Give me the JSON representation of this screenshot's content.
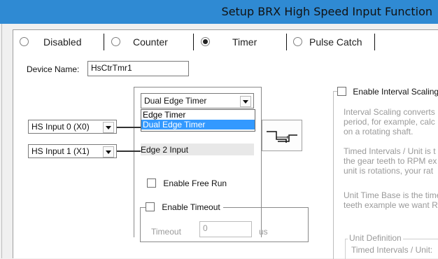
{
  "window": {
    "title": "Setup BRX High Speed Input Function"
  },
  "modes": [
    {
      "label": "Disabled",
      "selected": false
    },
    {
      "label": "Counter",
      "selected": false
    },
    {
      "label": "Timer",
      "selected": true
    },
    {
      "label": "Pulse Catch",
      "selected": false
    }
  ],
  "device": {
    "label": "Device Name:",
    "value": "HsCtrTmr1"
  },
  "timer_type": {
    "value": "Dual Edge Timer",
    "options": [
      "Edge Timer",
      "Dual Edge Timer"
    ],
    "highlighted": "Dual Edge Timer"
  },
  "inputs": [
    {
      "value": "HS Input 0 (X0)"
    },
    {
      "value": "HS Input 1 (X1)"
    }
  ],
  "edge2_label": "Edge 2 Input",
  "free_run": {
    "label": "Enable Free Run",
    "checked": false
  },
  "timeout": {
    "label": "Enable Timeout",
    "checked": false,
    "field_label": "Timeout",
    "value": "0",
    "unit": "us"
  },
  "interval": {
    "label": "Enable Interval Scaling",
    "checked": false,
    "lines": [
      "Interval Scaling converts",
      "period, for example, calc",
      "on a rotating shaft.",
      "Timed Intervals / Unit is t",
      "the gear teeth to RPM ex",
      "unit is rotations, your rat",
      "Unit Time Base is the time",
      "teeth example we want R"
    ],
    "unit_definition_label": "Unit Definition",
    "timed_intervals_label": "Timed Intervals / Unit:"
  }
}
